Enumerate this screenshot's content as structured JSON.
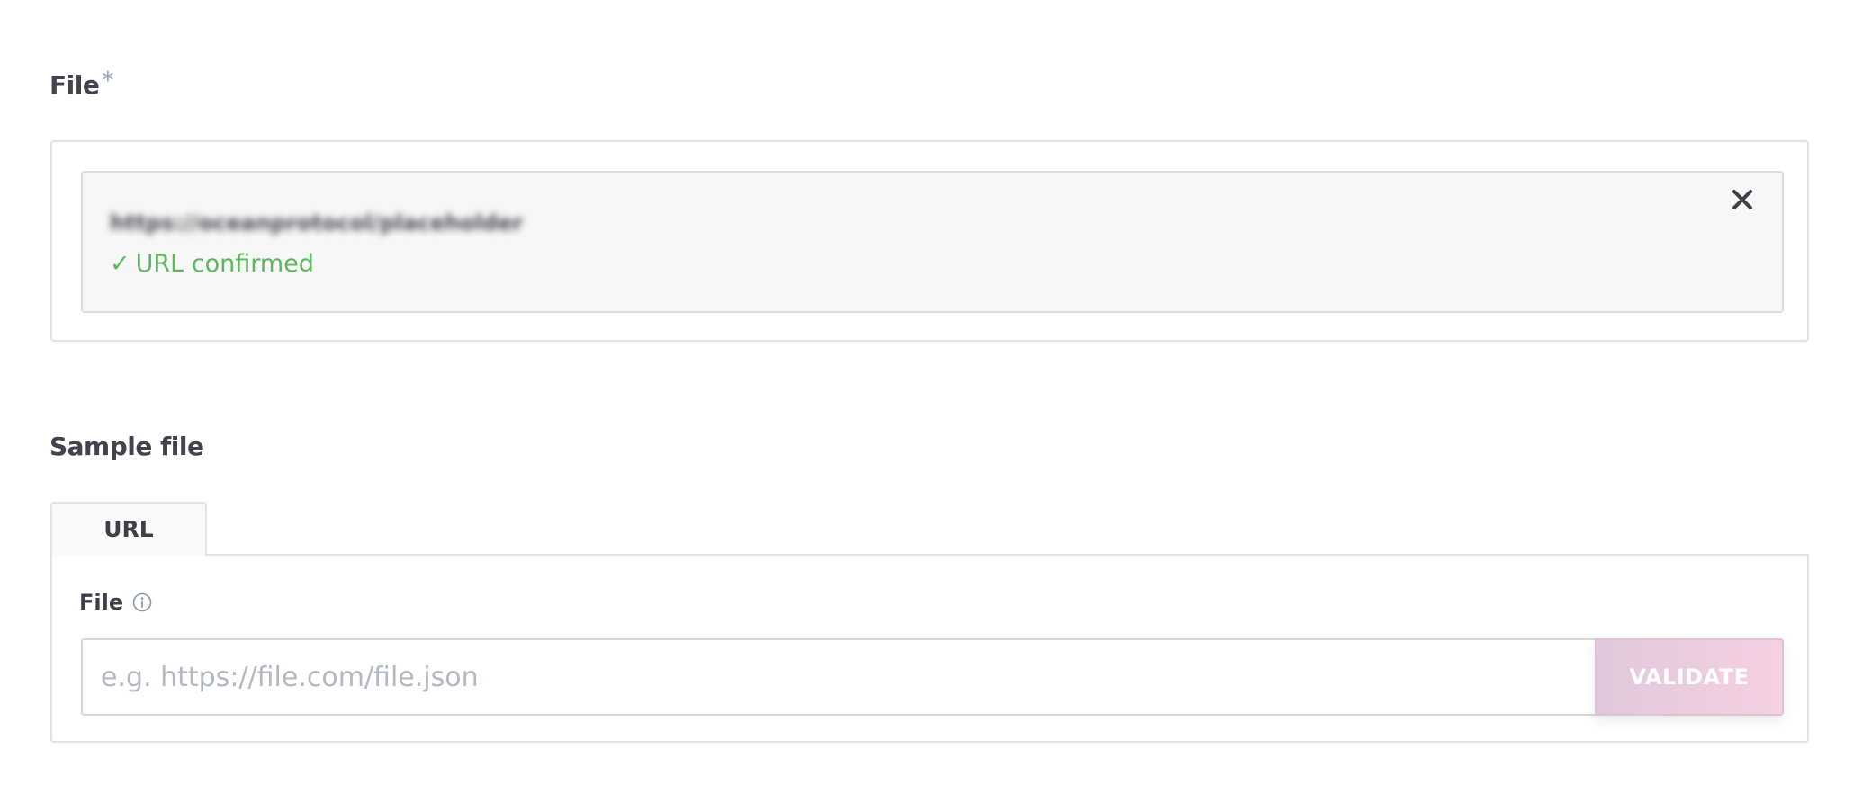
{
  "file_section": {
    "label": "File",
    "required_marker": "*",
    "confirmed_url": "https://oceanprotocol/placeholder",
    "status_text": "URL confirmed",
    "status_icon": "check-icon",
    "status_color": "#5cb85c",
    "remove_icon": "close-icon"
  },
  "sample_section": {
    "label": "Sample file",
    "tabs": [
      {
        "label": "URL",
        "active": true
      }
    ],
    "field_label": "File",
    "field_info_icon": "info-icon",
    "input": {
      "value": "",
      "placeholder": "e.g. https://file.com/file.json"
    },
    "validate_label": "VALIDATE",
    "validate_disabled": true
  }
}
